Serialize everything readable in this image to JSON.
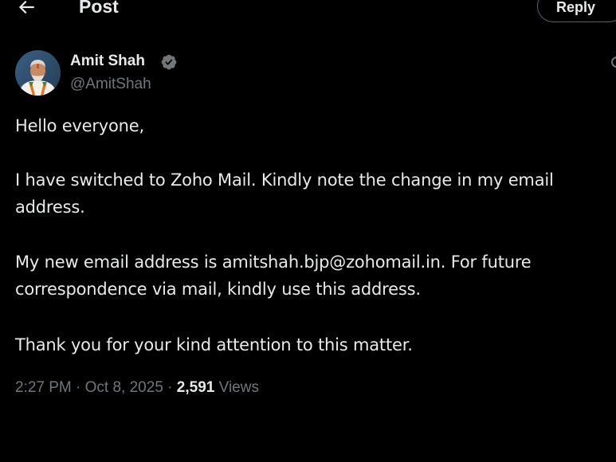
{
  "header": {
    "title": "Post",
    "reply_label": "Reply",
    "back_icon": "arrow-left-icon"
  },
  "author": {
    "name": "Amit Shah",
    "handle": "@AmitShah",
    "verified": true,
    "verified_color": "#1d9bf0"
  },
  "post": {
    "lines": [
      "Hello everyone,",
      "I have switched to Zoho Mail. Kindly note the change in my email",
      "address.",
      "My new email address is amitshah.bjp@zohomail.in. For future",
      "correspondence via mail, kindly use this address.",
      "Thank you for your kind attention to this matter."
    ]
  },
  "meta": {
    "time": "2:27 PM",
    "separator": "·",
    "date": "Oct 8, 2025",
    "views_count": "2,591",
    "views_label": "Views"
  },
  "colors": {
    "background": "#000000",
    "text_primary": "#e7e9ea",
    "text_secondary": "#71767b",
    "border": "#536471"
  }
}
